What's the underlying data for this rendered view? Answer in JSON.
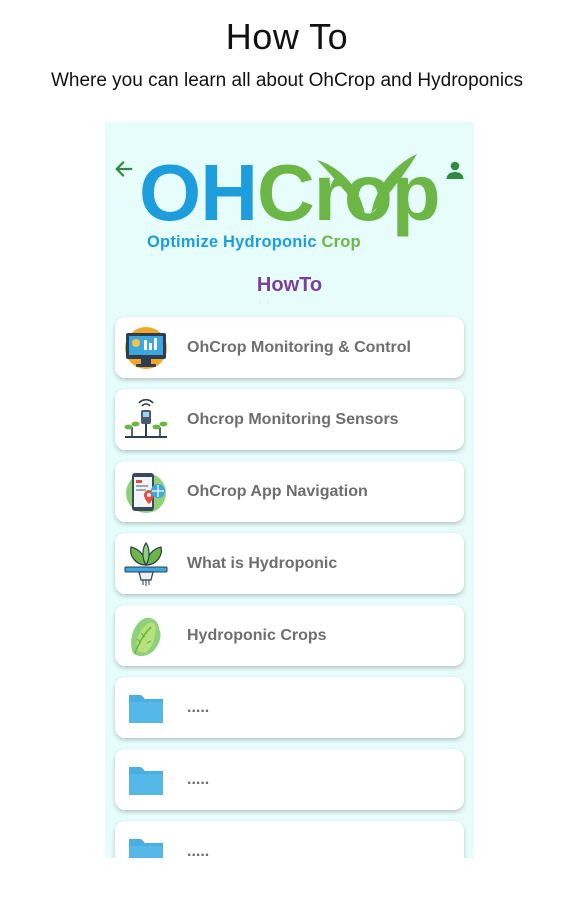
{
  "header": {
    "title": "How To",
    "subtitle": "Where you can learn all about OhCrop and Hydroponics"
  },
  "app": {
    "back_icon": "arrow-left-icon",
    "profile_icon": "person-icon",
    "logo": {
      "word_oh": "OH",
      "word_crop": "Crop",
      "tagline_part1": "Optimize Hydroponic",
      "tagline_part2": "Crop"
    },
    "section_title": "HowTo",
    "accent_green": "#2e8b3e",
    "title_purple": "#7b3f9a",
    "items": [
      {
        "label": "OhCrop Monitoring & Control",
        "icon": "monitor-dashboard-icon"
      },
      {
        "label": "Ohcrop Monitoring Sensors",
        "icon": "sensor-plant-icon"
      },
      {
        "label": "OhCrop App Navigation",
        "icon": "phone-map-icon"
      },
      {
        "label": "What is Hydroponic",
        "icon": "hydroponic-plant-icon"
      },
      {
        "label": "Hydroponic Crops",
        "icon": "lettuce-icon"
      },
      {
        "label": ".....",
        "icon": "folder-icon"
      },
      {
        "label": ".....",
        "icon": "folder-icon"
      },
      {
        "label": ".....",
        "icon": "folder-icon"
      }
    ]
  }
}
